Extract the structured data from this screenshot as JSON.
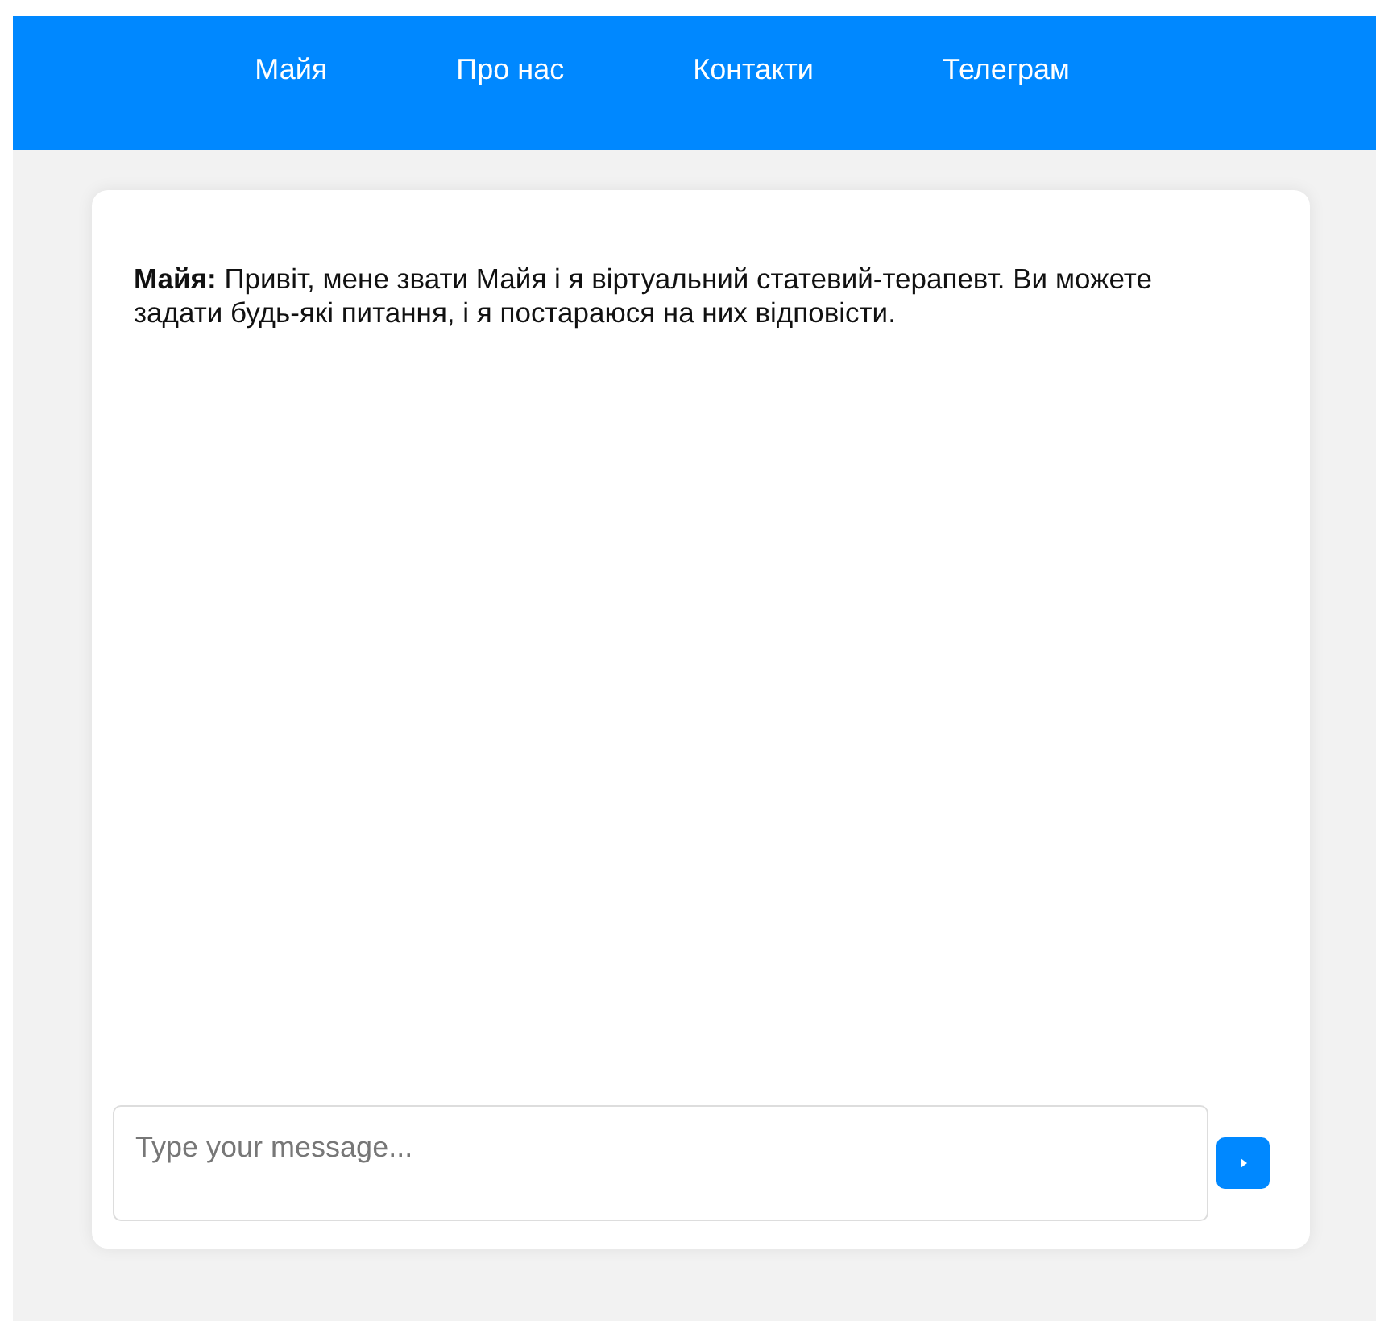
{
  "nav": {
    "items": [
      {
        "label": "Майя"
      },
      {
        "label": "Про нас"
      },
      {
        "label": "Контакти"
      },
      {
        "label": "Телеграм"
      }
    ]
  },
  "chat": {
    "messages": [
      "**Майя:** Привіт, мене звати Майя і я віртуальний статевий-терапевт. Ви можете задати будь-які питання, і я постараюся на них відповісти."
    ],
    "input": {
      "placeholder": "Type your message..."
    }
  }
}
